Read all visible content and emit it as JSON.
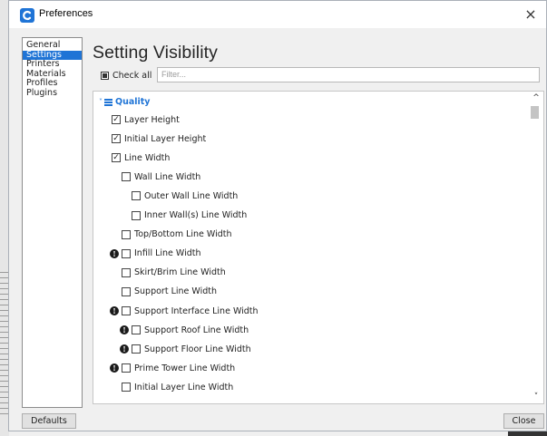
{
  "window": {
    "title": "Preferences",
    "close_glyph": "×",
    "app_icon": "cura-c-icon",
    "accent": "#1f74d6"
  },
  "sidebar": {
    "items": [
      {
        "label": "General",
        "active": false
      },
      {
        "label": "Settings",
        "active": true
      },
      {
        "label": "Printers",
        "active": false
      },
      {
        "label": "Materials",
        "active": false
      },
      {
        "label": "Profiles",
        "active": false
      },
      {
        "label": "Plugins",
        "active": false
      }
    ]
  },
  "main": {
    "heading": "Setting Visibility",
    "check_all_label": "Check all",
    "filter_placeholder": "Filter...",
    "category": {
      "label": "Quality",
      "chevron": "˅",
      "icon": "quality-bars-icon"
    },
    "settings": [
      {
        "label": "Layer Height",
        "checked": true,
        "info": false
      },
      {
        "label": "Initial Layer Height",
        "checked": true,
        "info": false
      },
      {
        "label": "Line Width",
        "checked": true,
        "info": false
      },
      {
        "label": "Wall Line Width",
        "checked": false,
        "info": false
      },
      {
        "label": "Outer Wall Line Width",
        "checked": false,
        "info": false
      },
      {
        "label": "Inner Wall(s) Line Width",
        "checked": false,
        "info": false
      },
      {
        "label": "Top/Bottom Line Width",
        "checked": false,
        "info": false
      },
      {
        "label": "Infill Line Width",
        "checked": false,
        "info": true
      },
      {
        "label": "Skirt/Brim Line Width",
        "checked": false,
        "info": false
      },
      {
        "label": "Support Line Width",
        "checked": false,
        "info": false
      },
      {
        "label": "Support Interface Line Width",
        "checked": false,
        "info": true
      },
      {
        "label": "Support Roof Line Width",
        "checked": false,
        "info": true
      },
      {
        "label": "Support Floor Line Width",
        "checked": false,
        "info": true
      },
      {
        "label": "Prime Tower Line Width",
        "checked": false,
        "info": true
      },
      {
        "label": "Initial Layer Line Width",
        "checked": false,
        "info": false
      }
    ],
    "scroll_up_glyph": "^",
    "scroll_down_glyph": "˅",
    "check_glyph": "✓",
    "info_glyph": "!"
  },
  "footer": {
    "defaults_label": "Defaults",
    "close_label": "Close"
  }
}
